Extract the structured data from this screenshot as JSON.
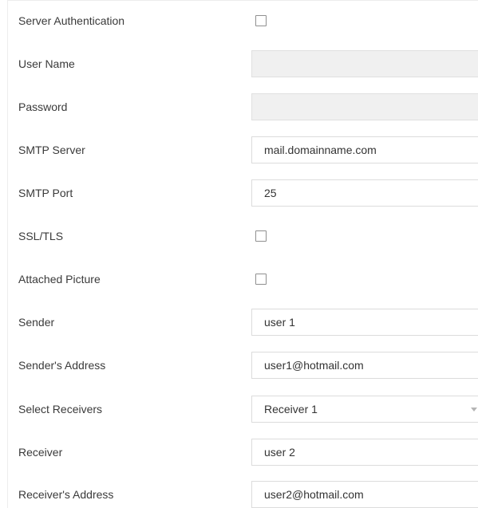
{
  "form": {
    "server_authentication": {
      "label": "Server Authentication",
      "checked": false
    },
    "user_name": {
      "label": "User Name",
      "value": ""
    },
    "password": {
      "label": "Password",
      "value": ""
    },
    "smtp_server": {
      "label": "SMTP Server",
      "value": "mail.domainname.com"
    },
    "smtp_port": {
      "label": "SMTP Port",
      "value": "25"
    },
    "ssl_tls": {
      "label": "SSL/TLS",
      "checked": false
    },
    "attached_picture": {
      "label": "Attached Picture",
      "checked": false
    },
    "sender": {
      "label": "Sender",
      "value": "user 1"
    },
    "senders_address": {
      "label": "Sender's Address",
      "value": "user1@hotmail.com"
    },
    "select_receivers": {
      "label": "Select Receivers",
      "value": "Receiver 1"
    },
    "receiver": {
      "label": "Receiver",
      "value": "user 2"
    },
    "receivers_address": {
      "label": "Receiver's Address",
      "value": "user2@hotmail.com"
    }
  },
  "icons": {
    "dropdown": "chevron-down-icon"
  },
  "colors": {
    "disabled_field": "#f0f0f0",
    "field_border": "#dcdcdc",
    "checkbox_border": "#8f8f8f"
  }
}
